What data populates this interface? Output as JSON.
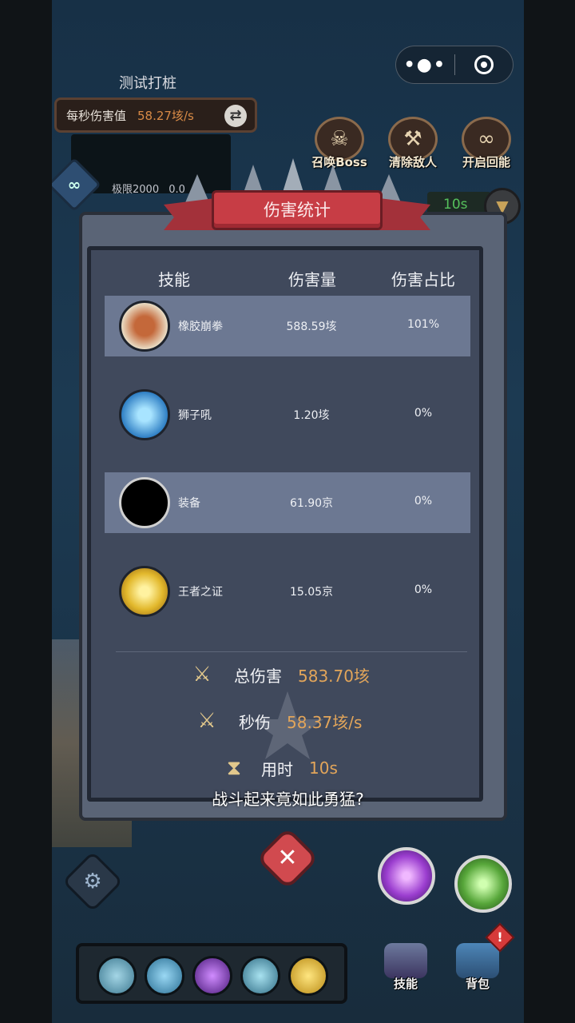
{
  "capsule": {
    "more_icon": "more-dots-icon",
    "close_icon": "target-close-icon"
  },
  "hud": {
    "test_label": "测试打桩",
    "dps_label": "每秒伤害值",
    "dps_value": "58.27垓/s",
    "limit_label": "极限2000",
    "limit_value": "0.0"
  },
  "actions": [
    {
      "label": "召唤Boss",
      "icon": "skull-crown-icon"
    },
    {
      "label": "清除敌人",
      "icon": "broom-icon"
    },
    {
      "label": "开启回能",
      "icon": "infinity-icon"
    }
  ],
  "timer": "10s",
  "modal": {
    "title": "伤害统计",
    "headers": {
      "skill": "技能",
      "damage": "伤害量",
      "share": "伤害占比"
    },
    "rows": [
      {
        "name": "橡胶崩拳",
        "damage": "588.59垓",
        "share": "101%",
        "icon": "rubber-fist-icon",
        "color": "#b85a2a"
      },
      {
        "name": "狮子吼",
        "damage": "1.20垓",
        "share": "0%",
        "icon": "lion-roar-icon",
        "color": "#3f9bd6"
      },
      {
        "name": "装备",
        "damage": "61.90京",
        "share": "0%",
        "icon": "equipment-icon",
        "color": "#000000"
      },
      {
        "name": "王者之证",
        "damage": "15.05京",
        "share": "0%",
        "icon": "king-proof-icon",
        "color": "#d8b22a"
      }
    ],
    "summary": {
      "total_label": "总伤害",
      "total_value": "583.70垓",
      "dps_label": "秒伤",
      "dps_value": "58.37垓/s",
      "time_label": "用时",
      "time_value": "10s"
    }
  },
  "subtitle": "战斗起来竟如此勇猛?",
  "nav": {
    "skills": "技能",
    "bag": "背包",
    "alert": "!"
  },
  "colors": {
    "accent_red": "#c73d45",
    "value_orange": "#e2a55a",
    "panel": "#40495c"
  }
}
